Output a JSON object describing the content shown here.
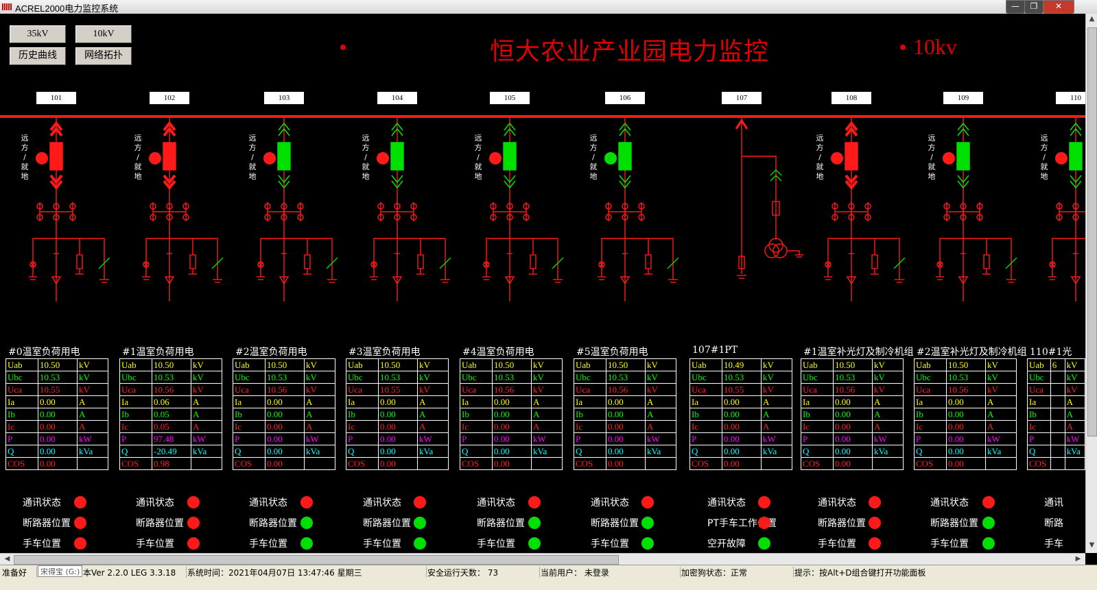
{
  "window": {
    "title": "ACREL2000电力监控系统",
    "controls": [
      "—",
      "❐",
      "✕"
    ]
  },
  "nav": {
    "btn_35kv": "35kV",
    "btn_10kv": "10kV",
    "btn_history": "历史曲线",
    "btn_topology": "网络拓扑"
  },
  "header": {
    "title": "恒大农业产业园电力监控",
    "level": "10kv"
  },
  "remote_label": [
    "远",
    "方",
    "/",
    "就",
    "地"
  ],
  "colors": {
    "red": "#ff1a1a",
    "green": "#00e000",
    "busbar": "#ff1a1a"
  },
  "feeders": [
    {
      "id": "101",
      "title": "#0温室负荷用电",
      "breaker": "red",
      "local": "red",
      "rows": [
        [
          "Uab",
          "10.50",
          "kV"
        ],
        [
          "Ubc",
          "10.53",
          "kV"
        ],
        [
          "Uca",
          "10.55",
          "kV"
        ],
        [
          "Ia",
          "0.00",
          "A"
        ],
        [
          "Ib",
          "0.00",
          "A"
        ],
        [
          "Ic",
          "0.00",
          "A"
        ],
        [
          "P",
          "0.00",
          "kW"
        ],
        [
          "Q",
          "0.00",
          "kVa"
        ],
        [
          "COS",
          "0.00",
          ""
        ]
      ],
      "status": [
        {
          "label": "通讯状态",
          "color": "red"
        },
        {
          "label": "断路器位置",
          "color": "red"
        },
        {
          "label": "手车位置",
          "color": "red"
        }
      ]
    },
    {
      "id": "102",
      "title": "#1温室负荷用电",
      "breaker": "red",
      "local": "red",
      "rows": [
        [
          "Uab",
          "10.50",
          "kV"
        ],
        [
          "Ubc",
          "10.53",
          "kV"
        ],
        [
          "Uca",
          "10.56",
          "kV"
        ],
        [
          "Ia",
          "0.06",
          "A"
        ],
        [
          "Ib",
          "0.05",
          "A"
        ],
        [
          "Ic",
          "0.05",
          "A"
        ],
        [
          "P",
          "97.48",
          "kW"
        ],
        [
          "Q",
          "-20.49",
          "kVa"
        ],
        [
          "COS",
          "0.98",
          ""
        ]
      ],
      "status": [
        {
          "label": "通讯状态",
          "color": "red"
        },
        {
          "label": "断路器位置",
          "color": "red"
        },
        {
          "label": "手车位置",
          "color": "red"
        }
      ]
    },
    {
      "id": "103",
      "title": "#2温室负荷用电",
      "breaker": "green",
      "local": "red",
      "rows": [
        [
          "Uab",
          "10.50",
          "kV"
        ],
        [
          "Ubc",
          "10.53",
          "kV"
        ],
        [
          "Uca",
          "10.56",
          "kV"
        ],
        [
          "Ia",
          "0.00",
          "A"
        ],
        [
          "Ib",
          "0.00",
          "A"
        ],
        [
          "Ic",
          "0.00",
          "A"
        ],
        [
          "P",
          "0.00",
          "kW"
        ],
        [
          "Q",
          "0.00",
          "kVa"
        ],
        [
          "COS",
          "0.00",
          ""
        ]
      ],
      "status": [
        {
          "label": "通讯状态",
          "color": "red"
        },
        {
          "label": "断路器位置",
          "color": "green"
        },
        {
          "label": "手车位置",
          "color": "green"
        }
      ]
    },
    {
      "id": "104",
      "title": "#3温室负荷用电",
      "breaker": "green",
      "local": "red",
      "rows": [
        [
          "Uab",
          "10.50",
          "kV"
        ],
        [
          "Ubc",
          "10.53",
          "kV"
        ],
        [
          "Uca",
          "10.55",
          "kV"
        ],
        [
          "Ia",
          "0.00",
          "A"
        ],
        [
          "Ib",
          "0.00",
          "A"
        ],
        [
          "Ic",
          "0.00",
          "A"
        ],
        [
          "P",
          "0.00",
          "kW"
        ],
        [
          "Q",
          "0.00",
          "kVa"
        ],
        [
          "COS",
          "0.00",
          ""
        ]
      ],
      "status": [
        {
          "label": "通讯状态",
          "color": "red"
        },
        {
          "label": "断路器位置",
          "color": "green"
        },
        {
          "label": "手车位置",
          "color": "green"
        }
      ]
    },
    {
      "id": "105",
      "title": "#4温室负荷用电",
      "breaker": "green",
      "local": "red",
      "rows": [
        [
          "Uab",
          "10.50",
          "kV"
        ],
        [
          "Ubc",
          "10.53",
          "kV"
        ],
        [
          "Uca",
          "10.56",
          "kV"
        ],
        [
          "Ia",
          "0.00",
          "A"
        ],
        [
          "Ib",
          "0.00",
          "A"
        ],
        [
          "Ic",
          "0.00",
          "A"
        ],
        [
          "P",
          "0.00",
          "kW"
        ],
        [
          "Q",
          "0.00",
          "kVa"
        ],
        [
          "COS",
          "0.00",
          ""
        ]
      ],
      "status": [
        {
          "label": "通讯状态",
          "color": "red"
        },
        {
          "label": "断路器位置",
          "color": "green"
        },
        {
          "label": "手车位置",
          "color": "green"
        }
      ]
    },
    {
      "id": "106",
      "title": "#5温室负荷用电",
      "breaker": "green",
      "local": "green",
      "rows": [
        [
          "Uab",
          "10.50",
          "kV"
        ],
        [
          "Ubc",
          "10.53",
          "kV"
        ],
        [
          "Uca",
          "10.56",
          "kV"
        ],
        [
          "Ia",
          "0.00",
          "A"
        ],
        [
          "Ib",
          "0.00",
          "A"
        ],
        [
          "Ic",
          "0.00",
          "A"
        ],
        [
          "P",
          "0.00",
          "kW"
        ],
        [
          "Q",
          "0.00",
          "kVa"
        ],
        [
          "COS",
          "0.00",
          ""
        ]
      ],
      "status": [
        {
          "label": "通讯状态",
          "color": "red"
        },
        {
          "label": "断路器位置",
          "color": "green"
        },
        {
          "label": "手车位置",
          "color": "green"
        }
      ]
    },
    {
      "id": "107",
      "title": "107#1PT",
      "pt": true,
      "rows": [
        [
          "Uab",
          "10.49",
          "kV"
        ],
        [
          "Ubc",
          "10.53",
          "kV"
        ],
        [
          "Uca",
          "10.55",
          "kV"
        ],
        [
          "Ia",
          "0.00",
          "A"
        ],
        [
          "Ib",
          "0.00",
          "A"
        ],
        [
          "Ic",
          "0.00",
          "A"
        ],
        [
          "P",
          "0.00",
          "kW"
        ],
        [
          "Q",
          "0.00",
          "kVa"
        ],
        [
          "COS",
          "0.00",
          ""
        ]
      ],
      "status": [
        {
          "label": "通讯状态",
          "color": "red"
        },
        {
          "label": "PT手车工作位置",
          "color": "red"
        },
        {
          "label": "空开故障",
          "color": "green"
        }
      ]
    },
    {
      "id": "108",
      "title": "#1温室补光灯及制冷机组",
      "breaker": "red",
      "local": "red",
      "rows": [
        [
          "Uab",
          "10.50",
          "kV"
        ],
        [
          "Ubc",
          "10.53",
          "kV"
        ],
        [
          "Uca",
          "10.56",
          "kV"
        ],
        [
          "Ia",
          "0.00",
          "A"
        ],
        [
          "Ib",
          "0.00",
          "A"
        ],
        [
          "Ic",
          "0.00",
          "A"
        ],
        [
          "P",
          "0.00",
          "kW"
        ],
        [
          "Q",
          "0.00",
          "kVa"
        ],
        [
          "COS",
          "0.00",
          ""
        ]
      ],
      "status": [
        {
          "label": "通讯状态",
          "color": "red"
        },
        {
          "label": "断路器位置",
          "color": "red"
        },
        {
          "label": "手车位置",
          "color": "red"
        }
      ]
    },
    {
      "id": "109",
      "title": "#2温室补光灯及制冷机组",
      "breaker": "green",
      "local": "red",
      "rows": [
        [
          "Uab",
          "10.50",
          "kV"
        ],
        [
          "Ubc",
          "10.53",
          "kV"
        ],
        [
          "Uca",
          "10.56",
          "kV"
        ],
        [
          "Ia",
          "0.00",
          "A"
        ],
        [
          "Ib",
          "0.00",
          "A"
        ],
        [
          "Ic",
          "0.00",
          "A"
        ],
        [
          "P",
          "0.00",
          "kW"
        ],
        [
          "Q",
          "0.00",
          "kVa"
        ],
        [
          "COS",
          "0.00",
          ""
        ]
      ],
      "status": [
        {
          "label": "通讯状态",
          "color": "red"
        },
        {
          "label": "断路器位置",
          "color": "green"
        },
        {
          "label": "手车位置",
          "color": "green"
        }
      ]
    },
    {
      "id": "110",
      "title": "110#1光",
      "breaker": "green",
      "local": "red",
      "partial": true,
      "rows": [
        [
          "Uab",
          "6",
          "kV"
        ],
        [
          "Ubc",
          "",
          "kV"
        ],
        [
          "Uca",
          "",
          "kV"
        ],
        [
          "Ia",
          "",
          "A"
        ],
        [
          "Ib",
          "",
          "A"
        ],
        [
          "Ic",
          "",
          "A"
        ],
        [
          "P",
          "",
          "kW"
        ],
        [
          "Q",
          "",
          "kVa"
        ],
        [
          "COS",
          "",
          ""
        ]
      ],
      "status": [
        {
          "label": "通讯",
          "color": "red"
        },
        {
          "label": "断路",
          "color": "red"
        },
        {
          "label": "手车",
          "color": "red"
        }
      ]
    }
  ],
  "statusbar": {
    "ready": "准备好",
    "tooltip": "宋得宝 (G:)",
    "version": "本Ver 2.2.0 LEG 3.3.18",
    "systime": "系统时间：2021年04月07日   13:47:46    星期三",
    "safedays": "安全运行天数：  73",
    "user": "当前用户：  未登录",
    "dongle": "加密狗状态：正常",
    "hint": "提示：按Alt+D组合键打开功能面板"
  }
}
